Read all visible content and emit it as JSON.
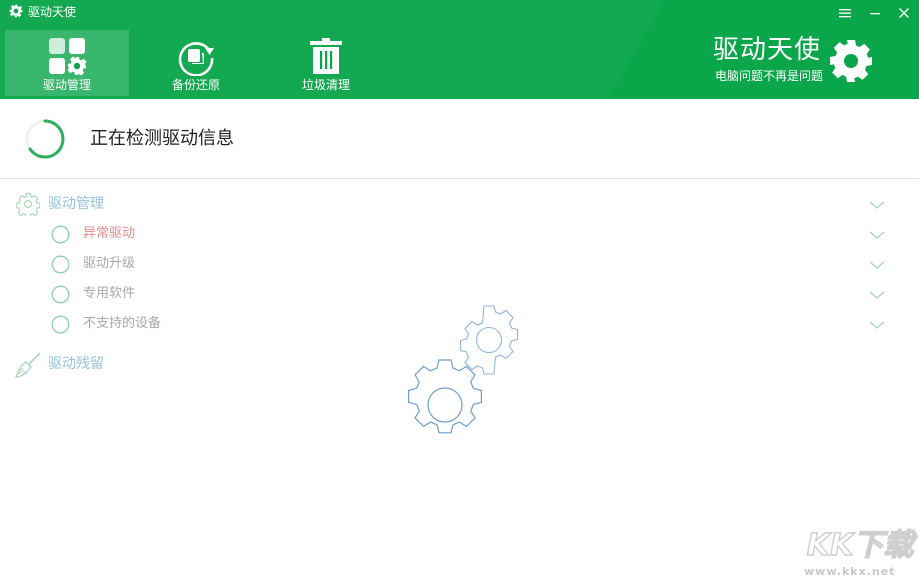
{
  "titlebar": {
    "title": "驱动天使",
    "icons": [
      "gear-icon",
      "menu-icon",
      "minimize-icon",
      "close-icon"
    ]
  },
  "nav": {
    "tabs": [
      {
        "label": "驱动管理",
        "icon": "grid-gear-icon",
        "active": true
      },
      {
        "label": "备份还原",
        "icon": "restore-icon",
        "active": false
      },
      {
        "label": "垃圾清理",
        "icon": "trash-icon",
        "active": false
      }
    ]
  },
  "brand": {
    "title": "驱动天使",
    "slogan": "电脑问题不再是问题",
    "icon": "gear-icon"
  },
  "status": {
    "text": "正在检测驱动信息",
    "icon": "spinner-icon"
  },
  "tree": {
    "driver_manage": {
      "label": "驱动管理",
      "icon": "gear-outline-icon"
    },
    "items": [
      {
        "label": "异常驱动",
        "status": "warning"
      },
      {
        "label": "驱动升级",
        "status": "normal"
      },
      {
        "label": "专用软件",
        "status": "normal"
      },
      {
        "label": "不支持的设备",
        "status": "normal"
      }
    ],
    "driver_residue": {
      "label": "驱动残留",
      "icon": "broom-icon"
    }
  },
  "watermark": {
    "logo": "KK下载",
    "url": "www.kkx.net"
  },
  "colors": {
    "header_green": "#0aa64a",
    "faded_label": "#98c3d7",
    "warning_label": "#e8898d",
    "illustration_blue": "#6e9ed0"
  }
}
